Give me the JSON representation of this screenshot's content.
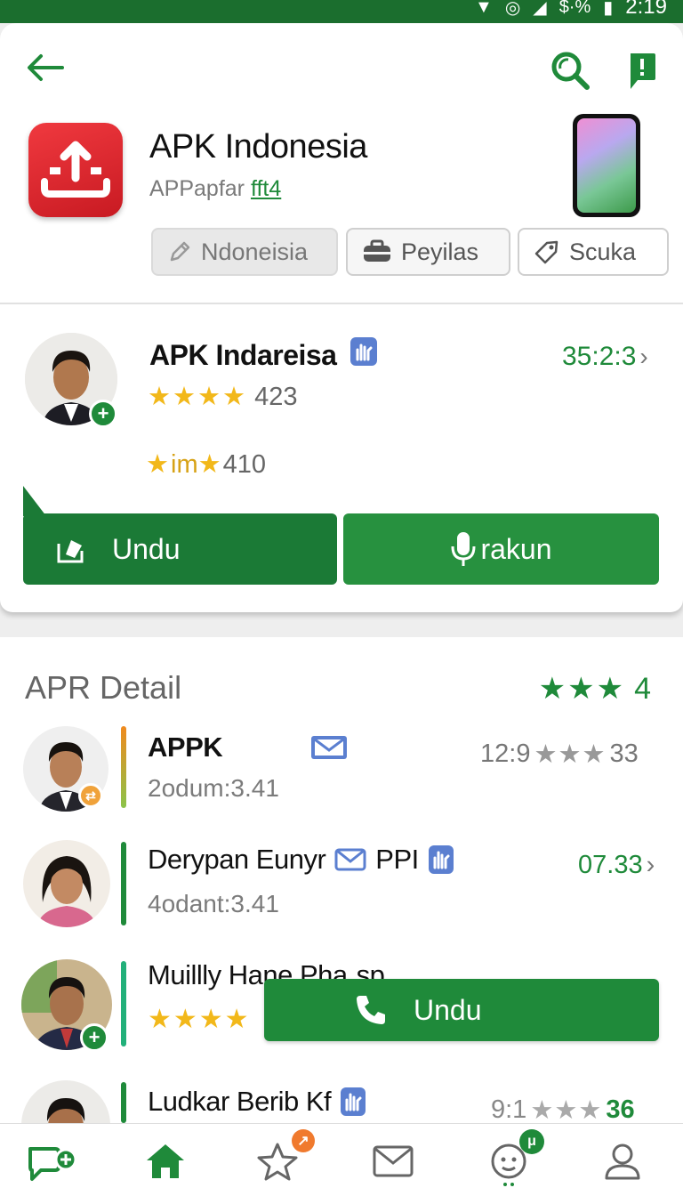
{
  "status_bar": {
    "time": "2:19",
    "signal_text": "$·%"
  },
  "app": {
    "title": "APK Indonesia",
    "subtitle": "APPapfar",
    "subtitle_link": "fft4"
  },
  "chips": [
    {
      "label": "Ndoneisia",
      "icon": "pencil-icon"
    },
    {
      "label": "Peyilas",
      "icon": "briefcase-icon"
    },
    {
      "label": "Scuka",
      "icon": "tag-icon"
    }
  ],
  "featured": {
    "name": "APK Indareisa",
    "time": "35:2:3",
    "rating_count": "423",
    "secondary_prefix": "im",
    "secondary_count": "410",
    "btn_primary": "Undu",
    "btn_secondary": "rakun"
  },
  "section": {
    "title": "APR Detail",
    "rating": "4",
    "rating_stars": "★★★"
  },
  "rows": [
    {
      "title": "APPK",
      "sub": "2odum:3.41",
      "right_text": "12:9",
      "right_stars": "★★★",
      "right_count": "33"
    },
    {
      "title": "Derypan Eunyr",
      "title_extra": "PPI",
      "sub": "4odant:3.41",
      "right_text": "07.33"
    },
    {
      "title": "Muillly Hane Pha",
      "title_extra": "sp",
      "stars": "★★★★"
    },
    {
      "title": "Ludkar Berib Kf",
      "right_text": "9:1",
      "right_stars": "★★★",
      "right_count": "36"
    }
  ],
  "float_button": {
    "label": "Undu"
  },
  "nav": {
    "star_badge": "↗",
    "face_badge": "μ"
  },
  "colors": {
    "primary": "#1f8a3a",
    "dark_primary": "#1b7a36",
    "brand_red": "#e0262e",
    "star": "#f2b81a"
  }
}
